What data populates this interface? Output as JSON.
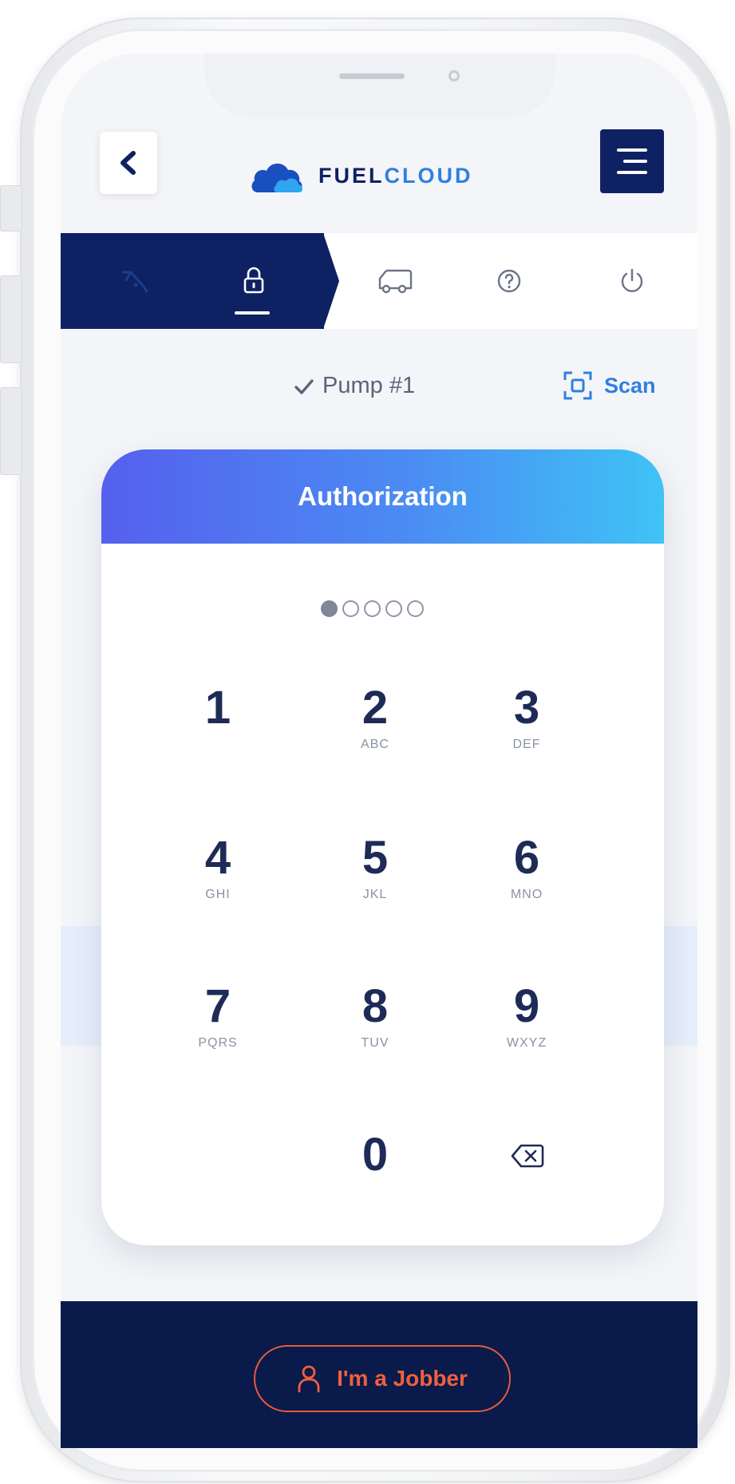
{
  "header": {
    "back_icon": "chevron-left-icon",
    "logo_text_part1": "FUEL",
    "logo_text_part2": "CLOUD",
    "menu_icon": "hamburger-menu-icon"
  },
  "steps": [
    {
      "icon": "fuel-nozzle-icon",
      "active": true
    },
    {
      "icon": "lock-icon",
      "active": true,
      "current": true
    },
    {
      "icon": "truck-icon",
      "active": false
    },
    {
      "icon": "help-circle-icon",
      "active": false
    },
    {
      "icon": "power-icon",
      "active": false
    }
  ],
  "pump": {
    "check_icon": "checkmark-icon",
    "label": "Pump #1"
  },
  "scan": {
    "icon": "scan-icon",
    "label": "Scan"
  },
  "authorization": {
    "title": "Authorization",
    "pin_length": 5,
    "pin_entered": 1
  },
  "keypad": [
    {
      "digit": "1",
      "letters": ""
    },
    {
      "digit": "2",
      "letters": "ABC"
    },
    {
      "digit": "3",
      "letters": "DEF"
    },
    {
      "digit": "4",
      "letters": "GHI"
    },
    {
      "digit": "5",
      "letters": "JKL"
    },
    {
      "digit": "6",
      "letters": "MNO"
    },
    {
      "digit": "7",
      "letters": "PQRS"
    },
    {
      "digit": "8",
      "letters": "TUV"
    },
    {
      "digit": "9",
      "letters": "WXYZ"
    },
    {
      "digit": "0",
      "letters": ""
    }
  ],
  "backspace_icon": "backspace-icon",
  "jobber": {
    "icon": "user-icon",
    "label": "I'm a Jobber"
  },
  "colors": {
    "navy": "#0e2163",
    "bottom_bar": "#0a1a4b",
    "gradient_start": "#5560ee",
    "gradient_end": "#3fc3f5",
    "accent_blue": "#2f7fe0",
    "jobber_orange": "#f0603c"
  }
}
